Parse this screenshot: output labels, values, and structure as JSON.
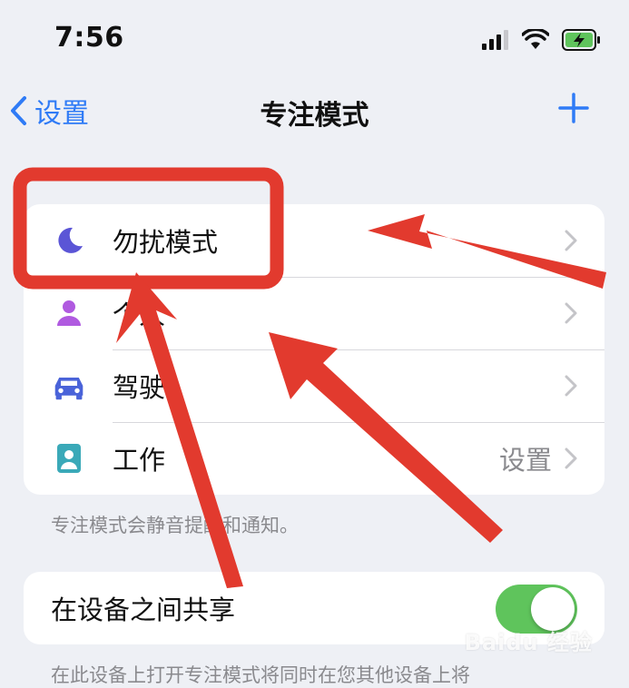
{
  "status_bar": {
    "time": "7:56"
  },
  "nav": {
    "back_label": "设置",
    "title": "专注模式"
  },
  "focus_modes": [
    {
      "label": "勿扰模式",
      "value": "",
      "icon": "moon-icon",
      "color": "#5b55d6"
    },
    {
      "label": "个人",
      "value": "",
      "icon": "person-icon",
      "color": "#b05ae0"
    },
    {
      "label": "驾驶",
      "value": "",
      "icon": "car-icon",
      "color": "#4a63d9"
    },
    {
      "label": "工作",
      "value": "设置",
      "icon": "id-badge-icon",
      "color": "#3aa9b8"
    }
  ],
  "focus_caption": "专注模式会静音提醒和通知。",
  "share": {
    "label": "在设备之间共享",
    "enabled": true
  },
  "share_caption": "在此设备上打开专注模式将同时在您其他设备上将",
  "annotation_color": "#e23a2e",
  "watermark": "Baidu 经验"
}
